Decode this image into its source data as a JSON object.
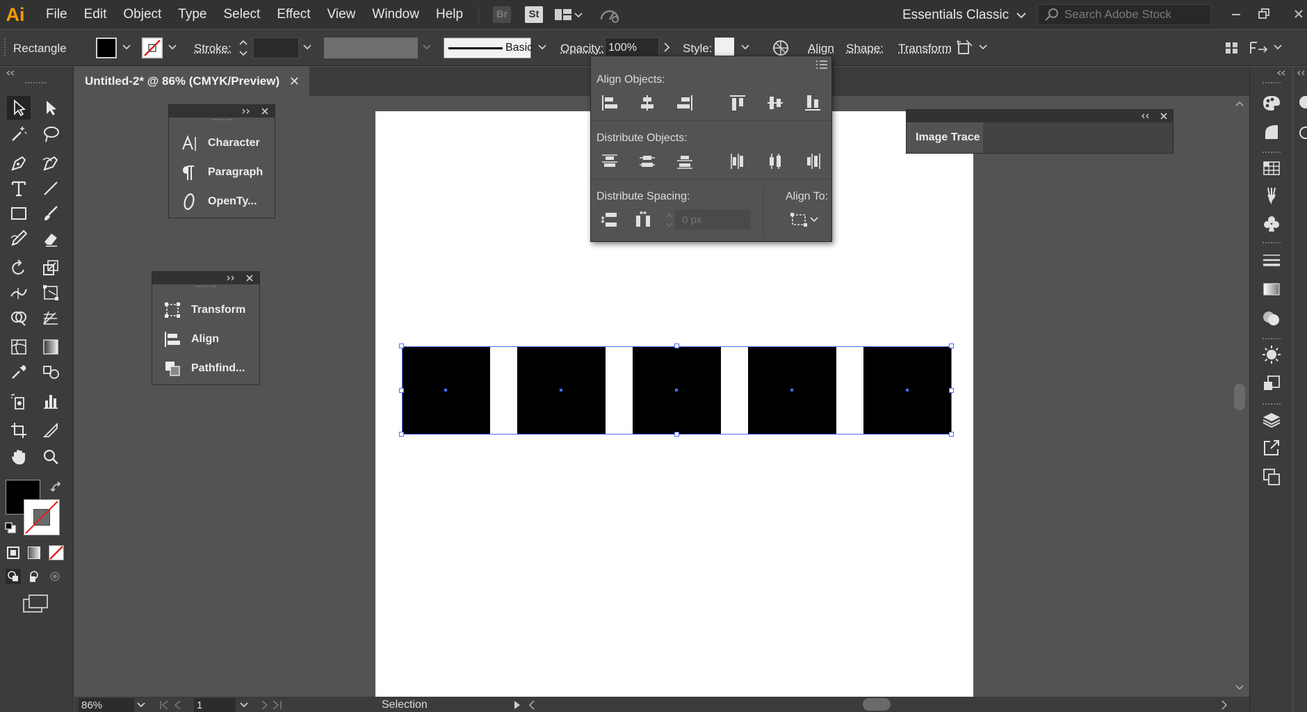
{
  "app": {
    "logo": "Ai",
    "accent_color": "#ff9a00"
  },
  "menu": [
    "File",
    "Edit",
    "Object",
    "Type",
    "Select",
    "Effect",
    "View",
    "Window",
    "Help"
  ],
  "menubar_badges": {
    "bridge": "Br",
    "stock": "St"
  },
  "workspace": "Essentials Classic",
  "search": {
    "placeholder": "Search Adobe Stock"
  },
  "controlbar": {
    "object_type": "Rectangle",
    "stroke_label": "Stroke:",
    "brush_label": "Basic",
    "opacity_label": "Opacity:",
    "opacity_value": "100%",
    "style_label": "Style:",
    "align_link": "Align",
    "shape_link": "Shape:",
    "transform_link": "Transform"
  },
  "document": {
    "tab_title": "Untitled-2* @ 86% (CMYK/Preview)"
  },
  "panels": {
    "type_panel": [
      "Character",
      "Paragraph",
      "OpenTy..."
    ],
    "transform_panel": [
      "Transform",
      "Align",
      "Pathfind..."
    ]
  },
  "align_panel": {
    "align_objects_label": "Align Objects:",
    "distribute_objects_label": "Distribute Objects:",
    "distribute_spacing_label": "Distribute Spacing:",
    "align_to_label": "Align To:",
    "spacing_placeholder": "0 px"
  },
  "image_trace": {
    "title": "Image Trace"
  },
  "statusbar": {
    "zoom": "86%",
    "artboard_number": "1",
    "status_text": "Selection"
  },
  "canvas": {
    "square_count": 5
  }
}
